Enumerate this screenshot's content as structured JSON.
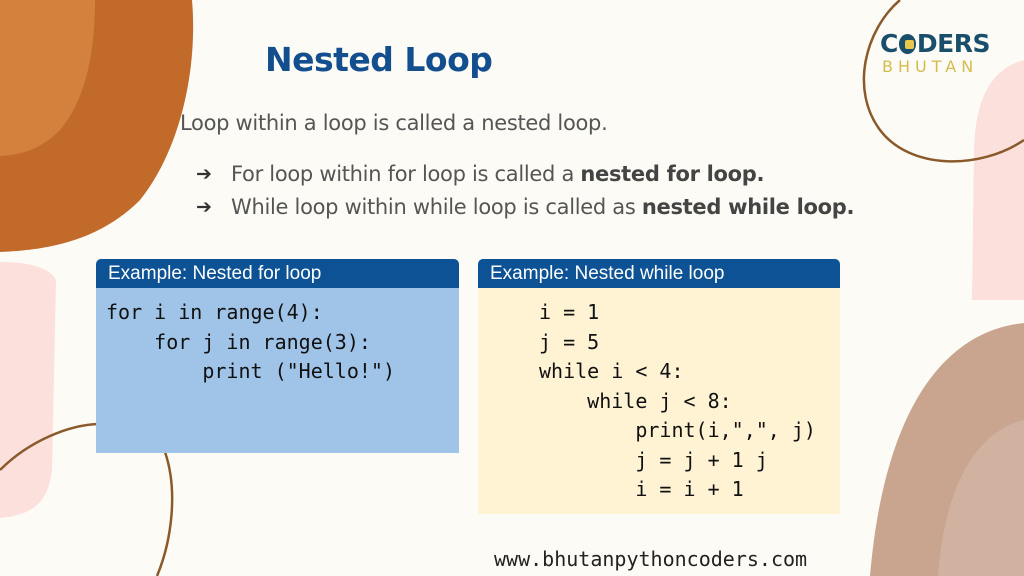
{
  "slide": {
    "title": "Nested Loop",
    "intro": "Loop within a loop is called a nested loop.",
    "bullets": [
      {
        "icon": "arrow-right-icon",
        "arrow": "➔",
        "text": "For loop within for loop is called a ",
        "bold": "nested for loop."
      },
      {
        "icon": "arrow-right-icon",
        "arrow": "➔",
        "text": "While loop within while loop is called as ",
        "bold": "nested while loop."
      }
    ]
  },
  "examples": {
    "for_loop": {
      "header": "Example: Nested for loop",
      "code": "for i in range(4):\n    for j in range(3):\n        print (\"Hello!\")"
    },
    "while_loop": {
      "header": "Example: Nested while loop",
      "code": "i = 1\nj = 5\nwhile i < 4:\n    while j < 8:\n        print(i,\",\", j)\n        j = j + 1 j\n        i = i + 1"
    }
  },
  "logo": {
    "top_pre": "C",
    "top_post": "DERS",
    "bottom": "BHUTAN"
  },
  "footer": {
    "website": "www.bhutanpythoncoders.com"
  },
  "colors": {
    "title_blue": "#134f8e",
    "header_blue": "#0d5294",
    "for_box_bg": "#9fc4e8",
    "while_box_bg": "#fff3d4",
    "orange_blob": "#c26a2a",
    "tan_blob": "#c9a590",
    "pink_blob": "#fbe0dc",
    "line_brown": "#8b5a2b"
  }
}
